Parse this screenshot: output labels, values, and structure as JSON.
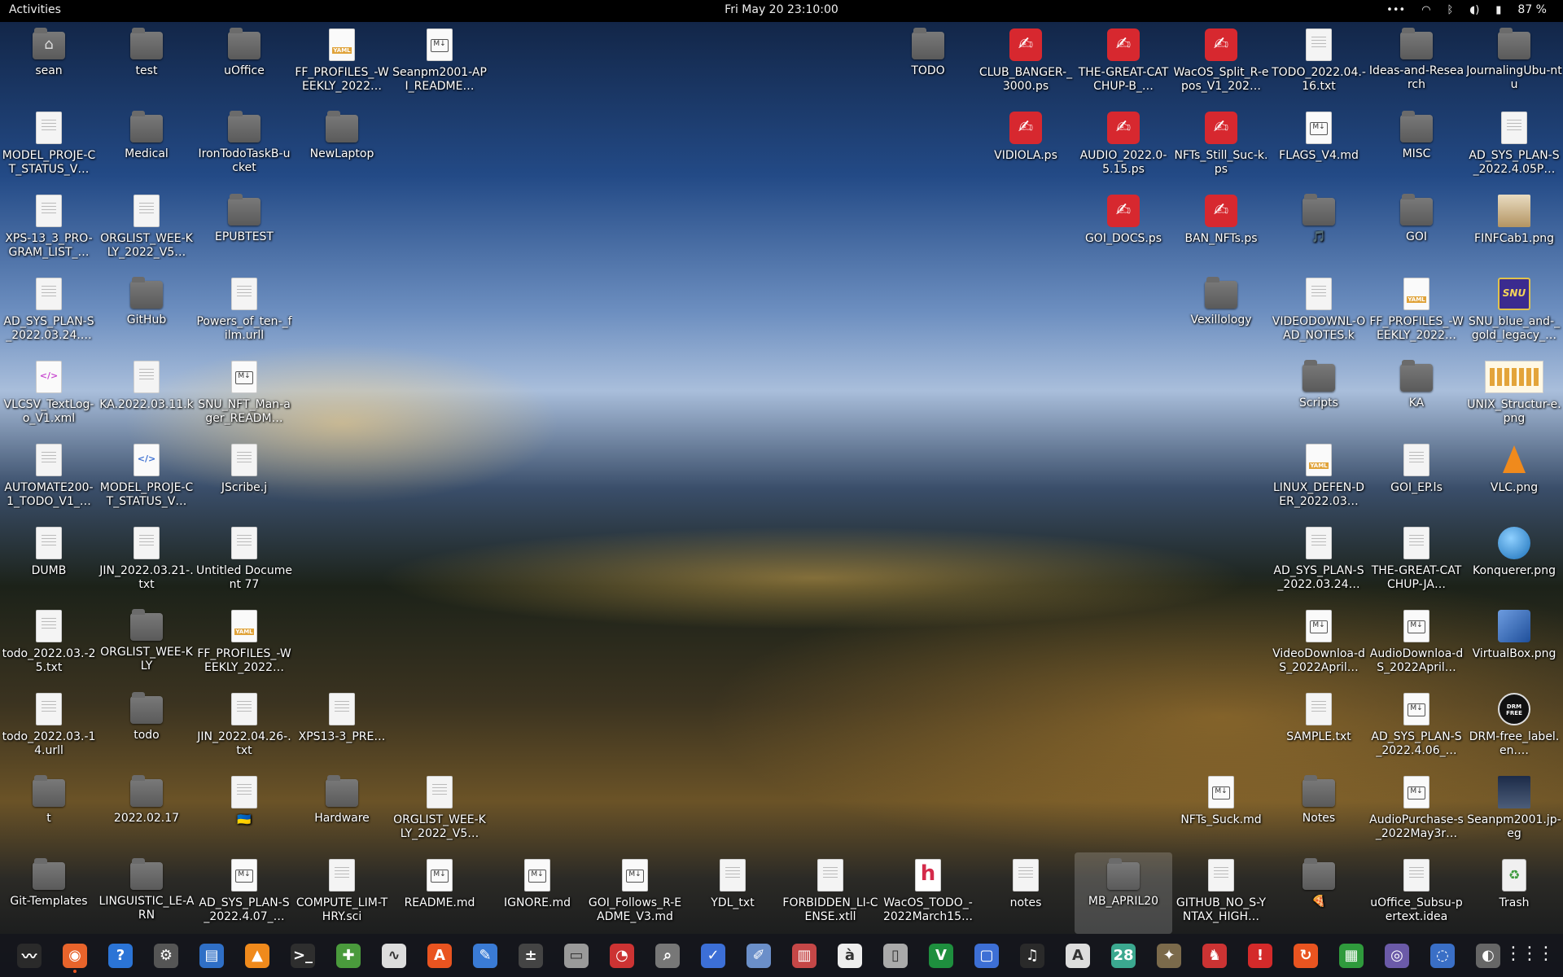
{
  "topbar": {
    "activities": "Activities",
    "clock": "Fri May 20  23:10:00",
    "tray": {
      "more": "•••",
      "wifi": "wifi-icon",
      "bluetooth": "bluetooth-icon",
      "volume": "volume-icon",
      "battery": "battery-icon",
      "battery_pct": "87 %"
    }
  },
  "desktop": {
    "icons": [
      {
        "label": "sean",
        "type": "home",
        "col": 0,
        "row": 0
      },
      {
        "label": "test",
        "type": "folder",
        "col": 1,
        "row": 0
      },
      {
        "label": "uOffice",
        "type": "folder",
        "col": 2,
        "row": 0
      },
      {
        "label": "FF_PROFILES_-WEEKLY_2022…",
        "type": "yaml",
        "col": 3,
        "row": 0
      },
      {
        "label": "Seanpm2001-API_README…",
        "type": "md",
        "col": 4,
        "row": 0
      },
      {
        "label": "TODO",
        "type": "folder",
        "col": 9,
        "row": 0
      },
      {
        "label": "CLUB_BANGER-_3000.ps",
        "type": "ps",
        "col": 10,
        "row": 0
      },
      {
        "label": "THE-GREAT-CATCHUP-B_…",
        "type": "ps",
        "col": 11,
        "row": 0
      },
      {
        "label": "WacOS_Split_R-epos_V1_202…",
        "type": "ps",
        "col": 12,
        "row": 0
      },
      {
        "label": "TODO_2022.04.-16.txt",
        "type": "doc",
        "col": 13,
        "row": 0
      },
      {
        "label": "Ideas-and-Research",
        "type": "folder",
        "col": 14,
        "row": 0
      },
      {
        "label": "JournalingUbu-ntu",
        "type": "folder",
        "col": 15,
        "row": 0
      },
      {
        "label": "MODEL_PROJE-CT_STATUS_V…",
        "type": "doc",
        "col": 0,
        "row": 1
      },
      {
        "label": "Medical",
        "type": "folder",
        "col": 1,
        "row": 1
      },
      {
        "label": "IronTodoTaskB-ucket",
        "type": "folder",
        "col": 2,
        "row": 1
      },
      {
        "label": "NewLaptop",
        "type": "folder",
        "col": 3,
        "row": 1
      },
      {
        "label": "VIDIOLA.ps",
        "type": "ps",
        "col": 10,
        "row": 1
      },
      {
        "label": "AUDIO_2022.0-5.15.ps",
        "type": "ps",
        "col": 11,
        "row": 1
      },
      {
        "label": "NFTs_Still_Suc-k.ps",
        "type": "ps",
        "col": 12,
        "row": 1
      },
      {
        "label": "FLAGS_V4.md",
        "type": "md",
        "col": 13,
        "row": 1
      },
      {
        "label": "MISC",
        "type": "folder",
        "col": 14,
        "row": 1
      },
      {
        "label": "AD_SYS_PLAN-S_2022.4.05P…",
        "type": "doc",
        "col": 15,
        "row": 1
      },
      {
        "label": "XPS-13_3_PRO-GRAM_LIST_…",
        "type": "doc",
        "col": 0,
        "row": 2
      },
      {
        "label": "ORGLIST_WEE-KLY_2022_V5…",
        "type": "doc",
        "col": 1,
        "row": 2
      },
      {
        "label": "EPUBTEST",
        "type": "folder",
        "col": 2,
        "row": 2
      },
      {
        "label": "GOI_DOCS.ps",
        "type": "ps",
        "col": 11,
        "row": 2
      },
      {
        "label": "BAN_NFTs.ps",
        "type": "ps",
        "col": 12,
        "row": 2
      },
      {
        "label": "🎵",
        "type": "folder",
        "col": 13,
        "row": 2
      },
      {
        "label": "GOI",
        "type": "folder",
        "col": 14,
        "row": 2
      },
      {
        "label": "FINFCab1.png",
        "type": "cab",
        "col": 15,
        "row": 2
      },
      {
        "label": "AD_SYS_PLAN-S_2022.03.24.…",
        "type": "doc",
        "col": 0,
        "row": 3
      },
      {
        "label": "GitHub",
        "type": "folder",
        "col": 1,
        "row": 3
      },
      {
        "label": "Powers_of_ten-_film.urll",
        "type": "doc",
        "col": 2,
        "row": 3
      },
      {
        "label": "Vexillology",
        "type": "folder",
        "col": 12,
        "row": 3
      },
      {
        "label": "VIDEODOWNL-OAD_NOTES.k",
        "type": "doc",
        "col": 13,
        "row": 3
      },
      {
        "label": "FF_PROFILES_-WEEKLY_2022…",
        "type": "yaml",
        "col": 14,
        "row": 3
      },
      {
        "label": "SNU_blue_and-_gold_legacy_…",
        "type": "snu",
        "col": 15,
        "row": 3
      },
      {
        "label": "VLCSV_TextLog-o_V1.xml",
        "type": "xml",
        "col": 0,
        "row": 4
      },
      {
        "label": "KA.2022.03.11.k",
        "type": "doc",
        "col": 1,
        "row": 4
      },
      {
        "label": "SNU_NFT_Man-ager_READM…",
        "type": "md",
        "col": 2,
        "row": 4
      },
      {
        "label": "Scripts",
        "type": "folder",
        "col": 13,
        "row": 4
      },
      {
        "label": "KA",
        "type": "folder",
        "col": 14,
        "row": 4
      },
      {
        "label": "UNIX_Structur-e.png",
        "type": "unix",
        "col": 15,
        "row": 4
      },
      {
        "label": "AUTOMATE200-1_TODO_V1_…",
        "type": "doc",
        "col": 0,
        "row": 5
      },
      {
        "label": "MODEL_PROJE-CT_STATUS_V…",
        "type": "xmlb",
        "col": 1,
        "row": 5
      },
      {
        "label": "JScribe.j",
        "type": "doc",
        "col": 2,
        "row": 5
      },
      {
        "label": "LINUX_DEFEN-DER_2022.03…",
        "type": "yaml",
        "col": 13,
        "row": 5
      },
      {
        "label": "GOI_EP.ls",
        "type": "doc",
        "col": 14,
        "row": 5
      },
      {
        "label": "VLC.png",
        "type": "vlc",
        "col": 15,
        "row": 5
      },
      {
        "label": "DUMB",
        "type": "doc",
        "col": 0,
        "row": 6
      },
      {
        "label": "JIN_2022.03.21-.txt",
        "type": "doc",
        "col": 1,
        "row": 6
      },
      {
        "label": "Untitled Document 77",
        "type": "doc",
        "col": 2,
        "row": 6
      },
      {
        "label": "AD_SYS_PLAN-S_2022.03.24…",
        "type": "doc",
        "col": 13,
        "row": 6
      },
      {
        "label": "THE-GREAT-CATCHUP-JA…",
        "type": "doc",
        "col": 14,
        "row": 6
      },
      {
        "label": "Konquerer.png",
        "type": "globe",
        "col": 15,
        "row": 6
      },
      {
        "label": "todo_2022.03.-25.txt",
        "type": "doc",
        "col": 0,
        "row": 7
      },
      {
        "label": "ORGLIST_WEE-KLY",
        "type": "folder",
        "col": 1,
        "row": 7
      },
      {
        "label": "FF_PROFILES_-WEEKLY_2022…",
        "type": "yaml",
        "col": 2,
        "row": 7
      },
      {
        "label": "VideoDownloa-dS_2022April…",
        "type": "md",
        "col": 13,
        "row": 7
      },
      {
        "label": "AudioDownloa-dS_2022April…",
        "type": "md",
        "col": 14,
        "row": 7
      },
      {
        "label": "VirtualBox.png",
        "type": "vbox",
        "col": 15,
        "row": 7
      },
      {
        "label": "todo_2022.03.-14.urll",
        "type": "doc",
        "col": 0,
        "row": 8
      },
      {
        "label": "todo",
        "type": "folder",
        "col": 1,
        "row": 8
      },
      {
        "label": "JIN_2022.04.26-.txt",
        "type": "doc",
        "col": 2,
        "row": 8
      },
      {
        "label": "XPS13-3_PRE…",
        "type": "doc",
        "col": 3,
        "row": 8
      },
      {
        "label": "SAMPLE.txt",
        "type": "doc",
        "col": 13,
        "row": 8
      },
      {
        "label": "AD_SYS_PLAN-S_2022.4.06_…",
        "type": "md",
        "col": 14,
        "row": 8
      },
      {
        "label": "DRM-free_label.en.…",
        "type": "drm",
        "col": 15,
        "row": 8
      },
      {
        "label": "t",
        "type": "folder",
        "col": 0,
        "row": 9
      },
      {
        "label": "2022.02.17",
        "type": "folder",
        "col": 1,
        "row": 9
      },
      {
        "label": "🇺🇦",
        "type": "doc",
        "col": 2,
        "row": 9
      },
      {
        "label": "Hardware",
        "type": "folder",
        "col": 3,
        "row": 9
      },
      {
        "label": "ORGLIST_WEE-KLY_2022_V5…",
        "type": "doc",
        "col": 4,
        "row": 9
      },
      {
        "label": "NFTs_Suck.md",
        "type": "md",
        "col": 12,
        "row": 9
      },
      {
        "label": "Notes",
        "type": "folder",
        "col": 13,
        "row": 9
      },
      {
        "label": "AudioPurchase-s_2022May3r…",
        "type": "md",
        "col": 14,
        "row": 9
      },
      {
        "label": "Seanpm2001.jp-eg",
        "type": "photo",
        "col": 15,
        "row": 9
      },
      {
        "label": "Git-Templates",
        "type": "folder",
        "col": 0,
        "row": 10
      },
      {
        "label": "LINGUISTIC_LE-ARN",
        "type": "folder",
        "col": 1,
        "row": 10
      },
      {
        "label": "AD_SYS_PLAN-S_2022.4.07_…",
        "type": "md",
        "col": 2,
        "row": 10
      },
      {
        "label": "COMPUTE_LIM-THRY.sci",
        "type": "doc",
        "col": 3,
        "row": 10
      },
      {
        "label": "README.md",
        "type": "md",
        "col": 4,
        "row": 10
      },
      {
        "label": "IGNORE.md",
        "type": "md",
        "col": 5,
        "row": 10
      },
      {
        "label": "GOI_Follows_R-EADME_V3.md",
        "type": "md",
        "col": 6,
        "row": 10
      },
      {
        "label": "YDL_txt",
        "type": "doc",
        "col": 7,
        "row": 10
      },
      {
        "label": "FORBIDDEN_LI-CENSE.xtll",
        "type": "doc",
        "col": 8,
        "row": 10
      },
      {
        "label": "WacOS_TODO_-2022March15…",
        "type": "h",
        "col": 9,
        "row": 10
      },
      {
        "label": "notes",
        "type": "doc",
        "col": 10,
        "row": 10
      },
      {
        "label": "MB_APRIL20",
        "type": "folder",
        "col": 11,
        "row": 10,
        "selected": true
      },
      {
        "label": "GITHUB_NO_S-YNTAX_HIGH…",
        "type": "doc",
        "col": 12,
        "row": 10
      },
      {
        "label": "🍕",
        "type": "folder",
        "col": 13,
        "row": 10
      },
      {
        "label": "uOffice_Subsu-pertext.idea",
        "type": "doc",
        "col": 14,
        "row": 10
      },
      {
        "label": "Trash",
        "type": "trash",
        "col": 15,
        "row": 10
      }
    ]
  },
  "dock": {
    "apps": [
      {
        "name": "system-monitor-icon",
        "glyph": "〰",
        "color": "#2a2a2a"
      },
      {
        "name": "firefox-icon",
        "glyph": "◉",
        "color": "#e8642b",
        "running": true
      },
      {
        "name": "help-icon",
        "glyph": "?",
        "color": "#2b74d6"
      },
      {
        "name": "settings-icon",
        "glyph": "⚙",
        "color": "#555555"
      },
      {
        "name": "libreoffice-writer-icon",
        "glyph": "▤",
        "color": "#2f6fc6"
      },
      {
        "name": "vlc-icon",
        "glyph": "▲",
        "color": "#f08a1c"
      },
      {
        "name": "terminal-icon",
        "glyph": ">_",
        "color": "#2e2e2e"
      },
      {
        "name": "puzzle-icon",
        "glyph": "✚",
        "color": "#4a9a3c"
      },
      {
        "name": "graph-icon",
        "glyph": "∿",
        "color": "#dddddd"
      },
      {
        "name": "software-center-icon",
        "glyph": "A",
        "color": "#e95420"
      },
      {
        "name": "text-editor-icon",
        "glyph": "✎",
        "color": "#3a7bd5"
      },
      {
        "name": "calculator-icon",
        "glyph": "±",
        "color": "#444444"
      },
      {
        "name": "files-icon",
        "glyph": "▭",
        "color": "#9a9a9a"
      },
      {
        "name": "disk-usage-icon",
        "glyph": "◔",
        "color": "#c33"
      },
      {
        "name": "search-icon",
        "glyph": "⌕",
        "color": "#777777"
      },
      {
        "name": "tasks-icon",
        "glyph": "✓",
        "color": "#3c6fd6"
      },
      {
        "name": "paint-icon",
        "glyph": "✐",
        "color": "#6b8fc9"
      },
      {
        "name": "reader-icon",
        "glyph": "▥",
        "color": "#c54747"
      },
      {
        "name": "character-map-icon",
        "glyph": "à",
        "color": "#eeeeee"
      },
      {
        "name": "archive-icon",
        "glyph": "▯",
        "color": "#aaaaaa"
      },
      {
        "name": "vim-icon",
        "glyph": "V",
        "color": "#1e8f3e"
      },
      {
        "name": "screenshot-icon",
        "glyph": "▢",
        "color": "#3d6fd5"
      },
      {
        "name": "music-icon",
        "glyph": "♫",
        "color": "#2a2a2a"
      },
      {
        "name": "pdf-icon",
        "glyph": "A",
        "color": "#dddddd"
      },
      {
        "name": "calendar-icon",
        "glyph": "28",
        "color": "#3ba88f"
      },
      {
        "name": "gimp-icon",
        "glyph": "✦",
        "color": "#7b6a4b"
      },
      {
        "name": "game-icon",
        "glyph": "♞",
        "color": "#c33"
      },
      {
        "name": "error-icon",
        "glyph": "!",
        "color": "#d42a2a"
      },
      {
        "name": "update-icon",
        "glyph": "↻",
        "color": "#e95420"
      },
      {
        "name": "spreadsheet-icon",
        "glyph": "▦",
        "color": "#2f9a3c"
      },
      {
        "name": "camera-icon",
        "glyph": "◎",
        "color": "#6b5aa8"
      },
      {
        "name": "blender-icon",
        "glyph": "◌",
        "color": "#3a6fc6"
      },
      {
        "name": "brightness-icon",
        "glyph": "◐",
        "color": "#666666"
      }
    ],
    "grid": "show-apps-grid-icon"
  }
}
